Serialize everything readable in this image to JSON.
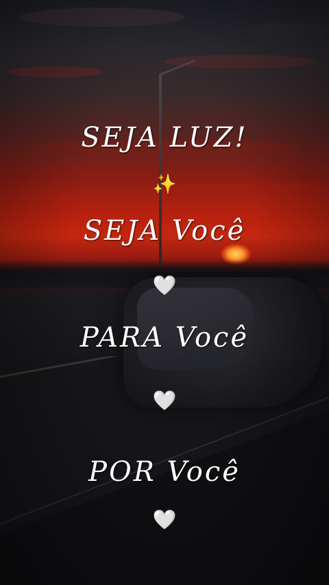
{
  "lyrics": {
    "line1": "SEJA LUZ!",
    "line2": "SEJA Você",
    "line3": "PARA Você",
    "line4": "POR Você"
  },
  "emojis": {
    "sparkles": "✨",
    "heart1": "🤍",
    "heart2": "🤍",
    "heart3": "🤍"
  },
  "colors": {
    "sky_dark": "#1d1f26",
    "sunset_red": "#c4270f",
    "text": "#ffffff"
  }
}
